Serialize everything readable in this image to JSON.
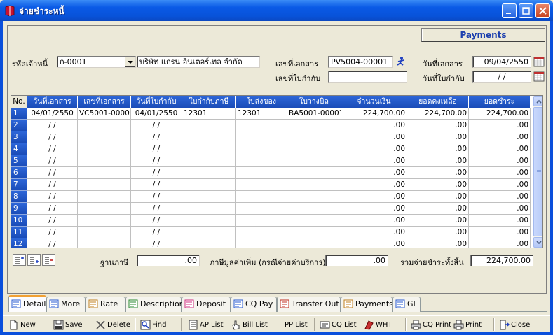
{
  "window": {
    "title": "จ่ายชำระหนี้"
  },
  "header": {
    "title_box": "Payments"
  },
  "form": {
    "creditor_code_label": "รหัสเจ้าหนี้",
    "creditor_code": "ก-0001",
    "creditor_name": "บริษัท แกรน อินเตอร์เทล จำกัด",
    "doc_no_label": "เลขที่เอกสาร",
    "doc_no": "PV5004-00001",
    "doc_date_label": "วันที่เอกสาร",
    "doc_date": "09/04/2550",
    "tax_invoice_no_label": "เลขที่ใบกำกับ",
    "tax_invoice_no": "",
    "tax_invoice_date_label": "วันที่ใบกำกับ",
    "tax_invoice_date": "/ /"
  },
  "grid": {
    "columns": [
      "No.",
      "วันที่เอกสาร",
      "เลขที่เอกสาร",
      "วันที่ใบกำกับ",
      "ใบกำกับภาษี",
      "ใบส่งของ",
      "ใบวางบิล",
      "จำนวนเงิน",
      "ยอดคงเหลือ",
      "ยอดชำระ"
    ],
    "rows": [
      [
        "1",
        "04/01/2550",
        "VC5001-00001",
        "04/01/2550",
        "12301",
        "12301",
        "BA5001-00001",
        "224,700.00",
        "224,700.00",
        "224,700.00"
      ],
      [
        "2",
        "/ /",
        "",
        "/ /",
        "",
        "",
        "",
        ".00",
        ".00",
        ".00"
      ],
      [
        "3",
        "/ /",
        "",
        "/ /",
        "",
        "",
        "",
        ".00",
        ".00",
        ".00"
      ],
      [
        "4",
        "/ /",
        "",
        "/ /",
        "",
        "",
        "",
        ".00",
        ".00",
        ".00"
      ],
      [
        "5",
        "/ /",
        "",
        "/ /",
        "",
        "",
        "",
        ".00",
        ".00",
        ".00"
      ],
      [
        "6",
        "/ /",
        "",
        "/ /",
        "",
        "",
        "",
        ".00",
        ".00",
        ".00"
      ],
      [
        "7",
        "/ /",
        "",
        "/ /",
        "",
        "",
        "",
        ".00",
        ".00",
        ".00"
      ],
      [
        "8",
        "/ /",
        "",
        "/ /",
        "",
        "",
        "",
        ".00",
        ".00",
        ".00"
      ],
      [
        "9",
        "/ /",
        "",
        "/ /",
        "",
        "",
        "",
        ".00",
        ".00",
        ".00"
      ],
      [
        "10",
        "/ /",
        "",
        "/ /",
        "",
        "",
        "",
        ".00",
        ".00",
        ".00"
      ],
      [
        "11",
        "/ /",
        "",
        "/ /",
        "",
        "",
        "",
        ".00",
        ".00",
        ".00"
      ],
      [
        "12",
        "/ /",
        "",
        "/ /",
        "",
        "",
        "",
        ".00",
        ".00",
        ".00"
      ]
    ]
  },
  "totals": {
    "tax_base_label": "ฐานภาษี",
    "tax_base": ".00",
    "vat_label": "ภาษีมูลค่าเพิ่ม (กรณีจ่ายค่าบริการ)",
    "vat": ".00",
    "grand_total_label": "รวมจ่ายชำระทั้งสิ้น",
    "grand_total": "224,700.00"
  },
  "tabs": [
    {
      "label": "Detail",
      "icon": "detail-icon"
    },
    {
      "label": "More",
      "icon": "more-icon"
    },
    {
      "label": "Rate",
      "icon": "rate-icon"
    },
    {
      "label": "Description",
      "icon": "description-icon"
    },
    {
      "label": "Deposit",
      "icon": "deposit-icon"
    },
    {
      "label": "CQ Pay",
      "icon": "cq-pay-icon"
    },
    {
      "label": "Transfer Out",
      "icon": "transfer-out-icon"
    },
    {
      "label": "Payments",
      "icon": "payments-icon"
    },
    {
      "label": "GL",
      "icon": "gl-icon"
    }
  ],
  "toolbar": {
    "new": "New",
    "save": "Save",
    "delete": "Delete",
    "find": "Find",
    "ap_list": "AP List",
    "bill_list": "Bill List",
    "pp_list": "PP List",
    "cq_list": "CQ List",
    "wht": "WHT",
    "cq_print": "CQ Print",
    "print": "Print",
    "close": "Close"
  },
  "colors": {
    "titlebar": "#0a5ae6",
    "grid_header": "#2d66d8",
    "active_tab_accent": "#f1a033",
    "payments_text": "#1c3fae"
  }
}
